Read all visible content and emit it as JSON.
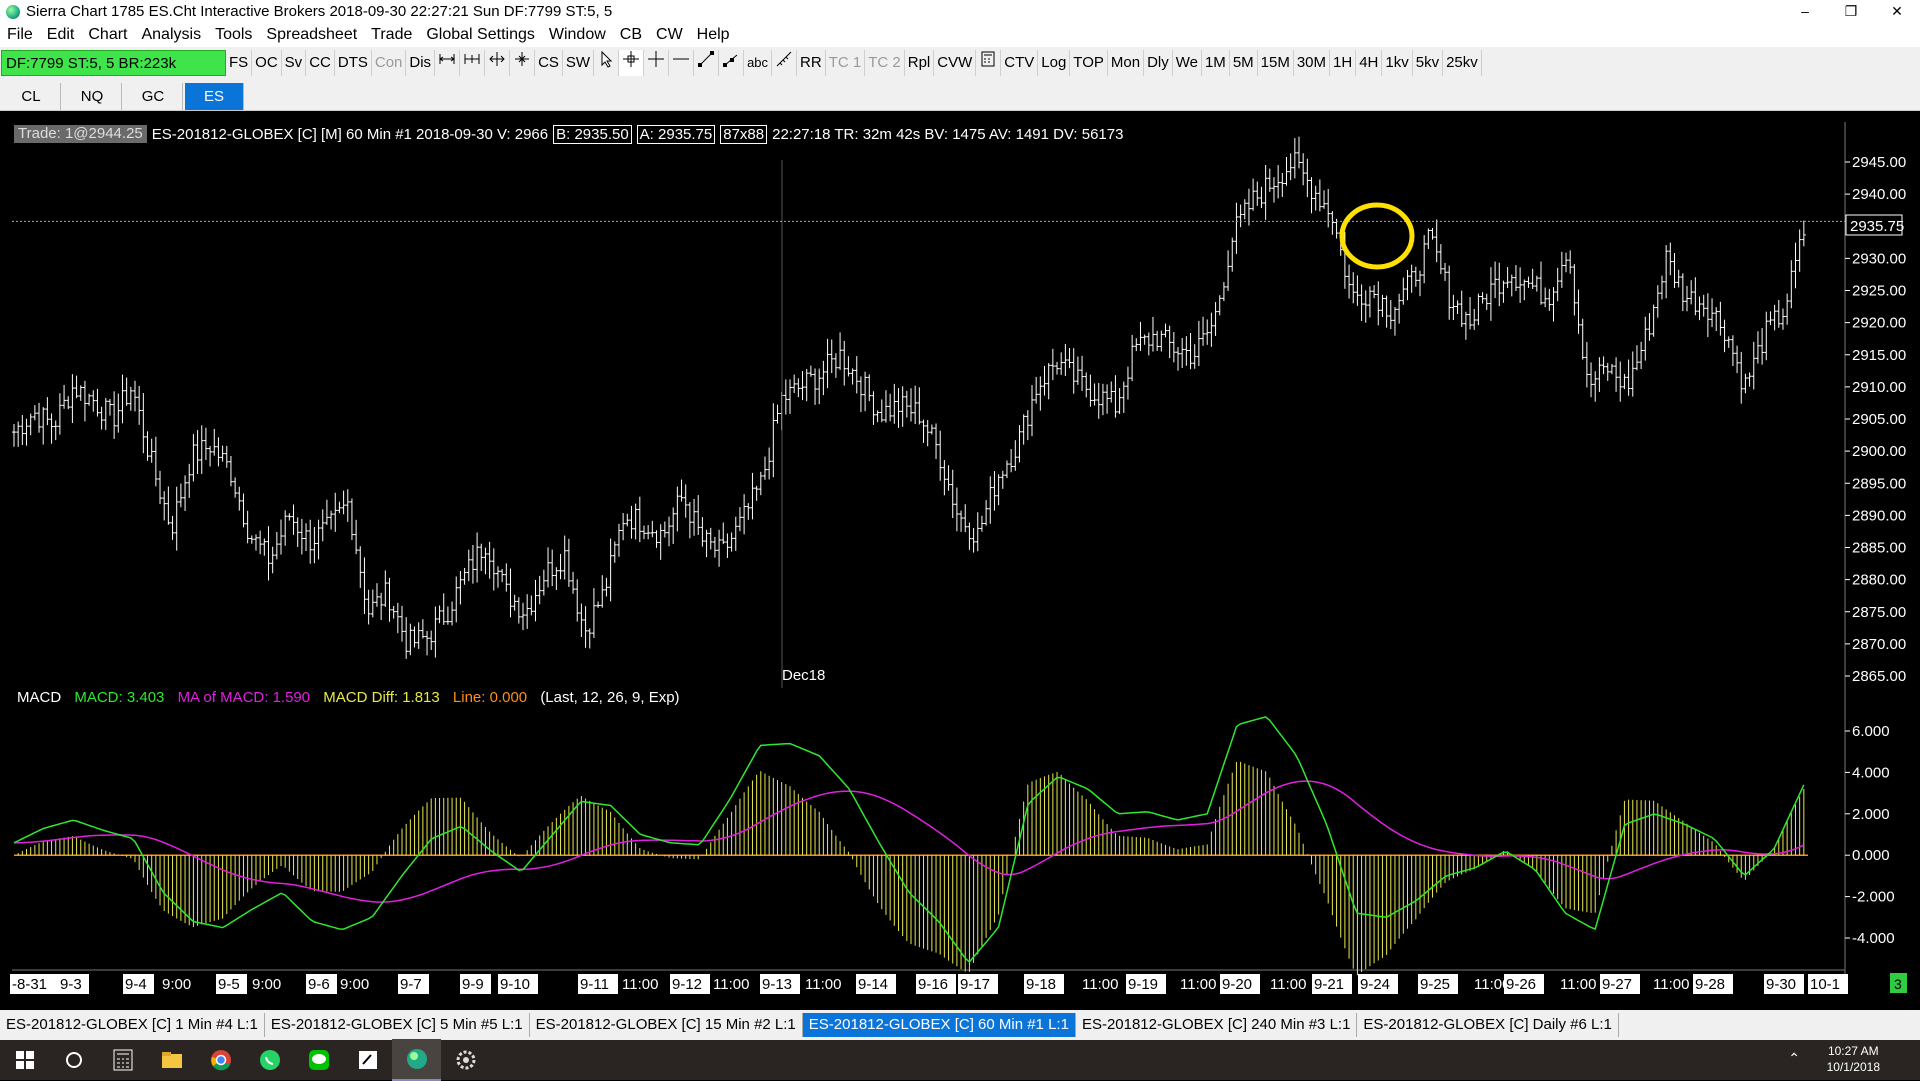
{
  "window": {
    "title": "Sierra Chart 1785 ES.Cht  Interactive Brokers 2018-09-30  22:27:21 Sun  DF:7799  ST:5, 5",
    "buttons": [
      "–",
      "❐",
      "✕"
    ]
  },
  "menu": [
    "File",
    "Edit",
    "Chart",
    "Analysis",
    "Tools",
    "Spreadsheet",
    "Trade",
    "Global Settings",
    "Window",
    "CB",
    "CW",
    "Help"
  ],
  "toolbar": {
    "status": "DF:7799  ST:5, 5  BR:223k",
    "buttons": [
      "FS",
      "OC",
      "Sv",
      "CC",
      "DTS",
      "Con",
      "Dis"
    ],
    "tools": [
      "CS",
      "SW"
    ],
    "buttons2": [
      "abc",
      "RR",
      "TC 1",
      "TC 2",
      "Rpl",
      "CVW"
    ],
    "buttons3": [
      "CTV",
      "Log",
      "TOP",
      "Mon",
      "Dly",
      "We",
      "1M",
      "5M",
      "15M",
      "30M",
      "1H",
      "4H",
      "1kv",
      "5kv",
      "25kv"
    ]
  },
  "symbol_tabs": [
    "CL",
    "NQ",
    "GC",
    "ES"
  ],
  "active_symbol_tab": "ES",
  "info": {
    "trade": "Trade: 1@2944.25",
    "symbol": "ES-201812-GLOBEX [C] [M]  60 Min   #1 2018-09-30  V: 2966",
    "bid": "B: 2935.50",
    "ask": "A: 2935.75",
    "size": "87x88",
    "rest": "22:27:18  TR: 32m 42s  BV: 1475  AV: 1491  DV: 56173"
  },
  "macd_legend": {
    "name": "MACD",
    "macd": "MACD: 3.403",
    "ma": "MA of MACD: 1.590",
    "diff": "MACD Diff: 1.813",
    "line": "Line: 0.000",
    "params": "(Last, 12, 26, 9, Exp)"
  },
  "price_label": "2935.75",
  "contract_label": "Dec18",
  "time_axis": [
    "-8-31",
    "9-3",
    "9-4",
    "9:00",
    "9-5",
    "9:00",
    "9-6",
    "9:00",
    "9-7",
    "9-9",
    "9-10",
    "9-11",
    "11:00",
    "9-12",
    "11:00",
    "9-13",
    "11:00",
    "9-14",
    "9-16",
    "9-17",
    "9-18",
    "11:00",
    "9-19",
    "11:00",
    "9-20",
    "11:00",
    "9-21",
    "9-24",
    "9-25",
    "11:00",
    "9-26",
    "11:00",
    "9-27",
    "11:00",
    "9-28",
    "9-30",
    "10-1"
  ],
  "bottom_tabs": [
    "ES-201812-GLOBEX [C]   1 Min   #4  L:1",
    "ES-201812-GLOBEX [C]   5 Min   #5  L:1",
    "ES-201812-GLOBEX [C]   15 Min   #2  L:1",
    "ES-201812-GLOBEX [C]   60 Min   #1  L:1",
    "ES-201812-GLOBEX [C]   240 Min   #3  L:1",
    "ES-201812-GLOBEX [C]   Daily  #6  L:1"
  ],
  "active_bottom_tab": 3,
  "clock": {
    "time": "10:27 AM",
    "date": "10/1/2018"
  },
  "scroll_badge": "3",
  "chart_data": [
    {
      "type": "ohlc",
      "price_axis": {
        "ticks": [
          "2945.00",
          "2940.00",
          "2935.75",
          "2930.00",
          "2925.00",
          "2920.00",
          "2915.00",
          "2910.00",
          "2905.00",
          "2900.00",
          "2895.00",
          "2890.00",
          "2885.00",
          "2880.00",
          "2875.00",
          "2870.00",
          "2865.00"
        ],
        "range": [
          2864,
          2949
        ]
      },
      "close_path": [
        2903,
        2906,
        2904,
        2910,
        2908,
        2905,
        2910,
        2898,
        2888,
        2899,
        2901,
        2897,
        2887,
        2883,
        2890,
        2886,
        2888,
        2892,
        2875,
        2878,
        2870,
        2871,
        2875,
        2881,
        2886,
        2878,
        2875,
        2881,
        2884,
        2872,
        2878,
        2890,
        2889,
        2887,
        2893,
        2886,
        2884,
        2889,
        2895,
        2908,
        2910,
        2912,
        2915,
        2911,
        2906,
        2907,
        2906,
        2900,
        2890,
        2887,
        2896,
        2901,
        2910,
        2914,
        2911,
        2909,
        2907,
        2916,
        2918,
        2916,
        2915,
        2920,
        2934,
        2939,
        2942,
        2945,
        2941,
        2937,
        2924,
        2925,
        2922,
        2926,
        2933,
        2924,
        2920,
        2925,
        2928,
        2926,
        2924,
        2932,
        2910,
        2913,
        2910,
        2918,
        2930,
        2924,
        2923,
        2919,
        2910,
        2918,
        2922,
        2934
      ]
    },
    {
      "type": "macd",
      "value_axis": {
        "ticks": [
          "6.000",
          "4.000",
          "2.000",
          "0.000",
          "-2.000",
          "-4.000"
        ],
        "range": [
          -5.5,
          7
        ]
      },
      "macd": [
        0.6,
        1.3,
        1.7,
        1.2,
        0.8,
        -1.8,
        -3.2,
        -3.5,
        -2.6,
        -1.8,
        -3.2,
        -3.6,
        -3.0,
        -1.0,
        0.8,
        1.4,
        0.2,
        -0.8,
        0.9,
        2.6,
        2.4,
        1.0,
        0.6,
        0.5,
        2.7,
        5.3,
        5.4,
        4.8,
        3.2,
        0.6,
        -1.8,
        -3.2,
        -5.2,
        -3.5,
        2.5,
        3.8,
        3.2,
        2.0,
        2.1,
        1.7,
        2.0,
        6.3,
        6.7,
        4.8,
        1.5,
        -2.8,
        -3.0,
        -2.2,
        -1.0,
        -0.6,
        0.2,
        -0.7,
        -2.8,
        -3.6,
        1.5,
        2.0,
        1.5,
        0.8,
        -1.0,
        0.3,
        3.4
      ]
    }
  ]
}
